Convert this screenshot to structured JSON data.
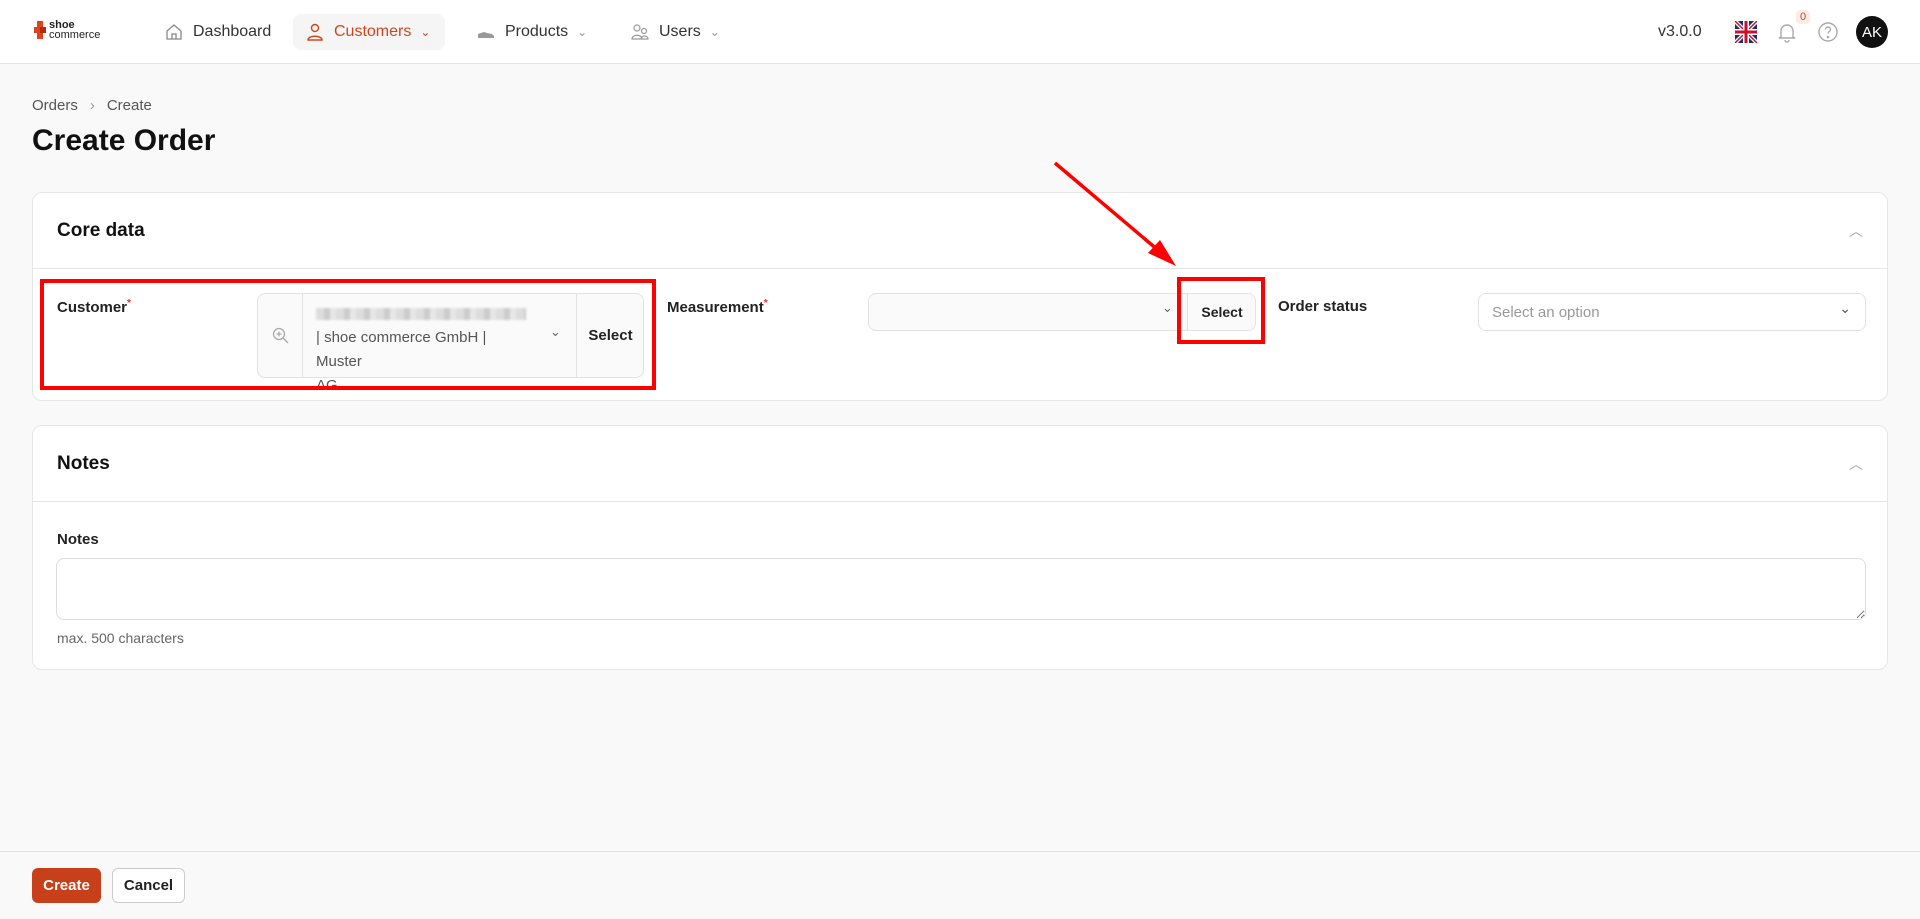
{
  "nav": {
    "logo_top": "shoe",
    "logo_bottom": "commerce",
    "items": [
      {
        "label": "Dashboard",
        "icon": "home-icon"
      },
      {
        "label": "Customers",
        "icon": "user-icon",
        "active": true
      },
      {
        "label": "Products",
        "icon": "shoe-icon"
      },
      {
        "label": "Users",
        "icon": "users-icon"
      }
    ],
    "version": "v3.0.0",
    "notifications": "0",
    "avatar": "AK",
    "accent": "#d0461c"
  },
  "breadcrumb": [
    "Orders",
    "Create"
  ],
  "title": "Create Order",
  "core": {
    "title": "Core data",
    "customer_label": "Customer",
    "customer_value_line2": "| shoe commerce GmbH | Muster",
    "customer_value_line3": "AG",
    "select_label": "Select",
    "measurement_label": "Measurement",
    "measurement_select": "Select",
    "order_status_label": "Order status",
    "order_status_placeholder": "Select an option"
  },
  "notes": {
    "title": "Notes",
    "label": "Notes",
    "hint": "max. 500 characters",
    "value": ""
  },
  "footer": {
    "create": "Create",
    "cancel": "Cancel"
  }
}
